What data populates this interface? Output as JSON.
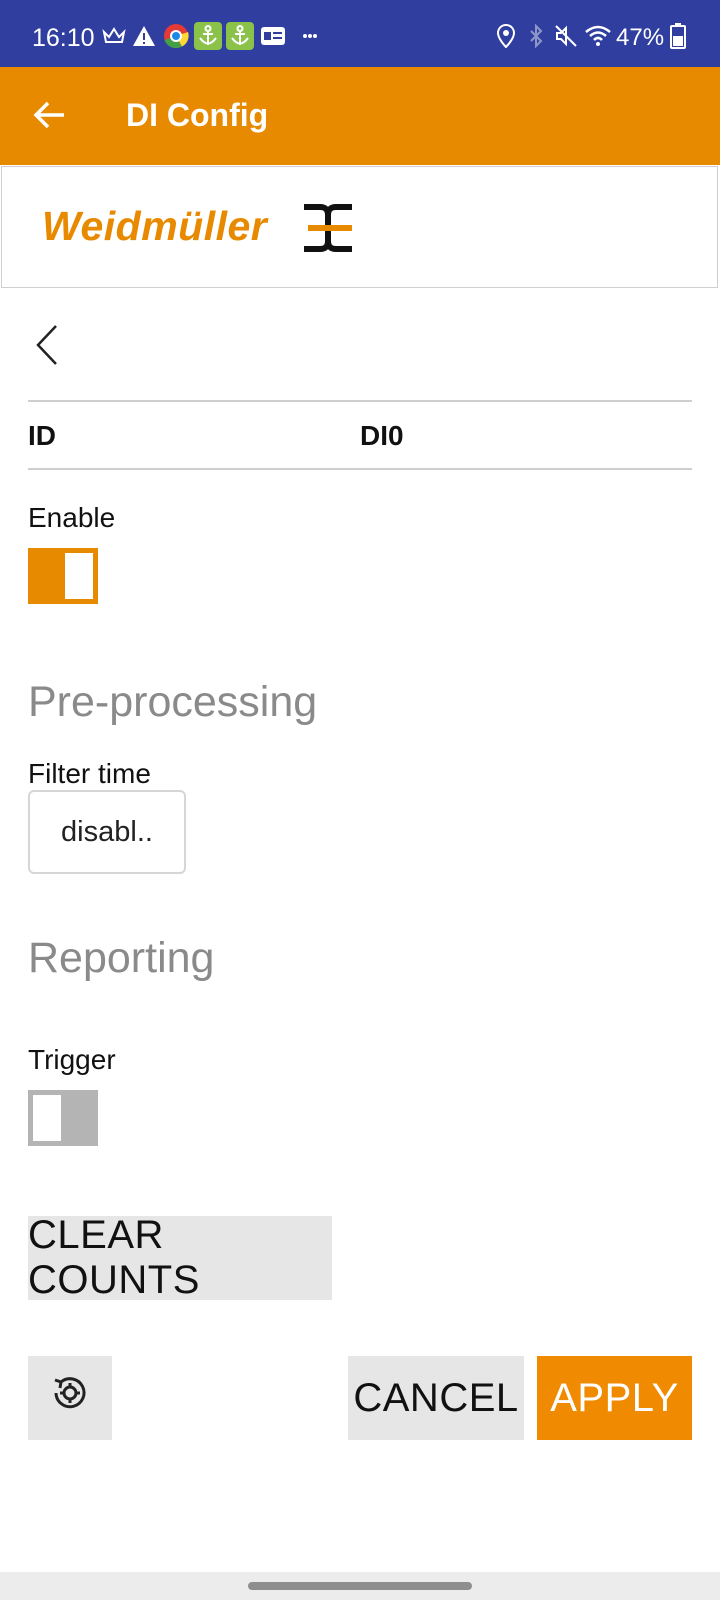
{
  "status_bar": {
    "time": "16:10",
    "battery_percent": "47%",
    "background": "#303f9f",
    "left_icons": [
      "crown-icon",
      "warning-icon",
      "chrome-icon",
      "anchor-icon",
      "anchor-icon",
      "id-card-icon",
      "more-dots-icon"
    ],
    "right_icons": [
      "location-icon",
      "bluetooth-icon",
      "mute-icon",
      "wifi-icon",
      "battery-icon"
    ]
  },
  "app_bar": {
    "title": "DI Config",
    "color": "#e88a00"
  },
  "brand": {
    "logo_text": "Weidmüller",
    "color": "#e88a00"
  },
  "id_row": {
    "label": "ID",
    "value": "DI0"
  },
  "enable": {
    "label": "Enable",
    "checked": true
  },
  "preprocessing": {
    "heading": "Pre-processing",
    "filter_time_label": "Filter time",
    "filter_time_value": "disabl.."
  },
  "reporting": {
    "heading": "Reporting",
    "trigger_label": "Trigger",
    "trigger_checked": false
  },
  "actions": {
    "clear_counts": "CLEAR COUNTS",
    "cancel": "CANCEL",
    "apply": "APPLY"
  }
}
